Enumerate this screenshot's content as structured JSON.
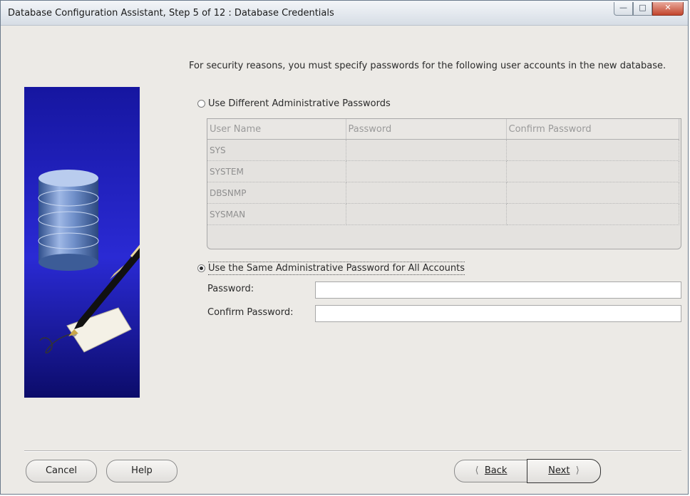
{
  "window": {
    "title": "Database Configuration Assistant, Step 5 of 12 : Database Credentials",
    "controls": [
      "minimize",
      "maximize",
      "close"
    ]
  },
  "intro": "For security reasons, you must specify passwords for the following user accounts in the new database.",
  "options": {
    "different": {
      "label": "Use Different Administrative Passwords",
      "selected": false
    },
    "same": {
      "label": "Use the Same Administrative Password for All Accounts",
      "selected": true
    }
  },
  "grid": {
    "columns": [
      "User Name",
      "Password",
      "Confirm Password"
    ],
    "rows": [
      {
        "user": "SYS",
        "password": "",
        "confirm": ""
      },
      {
        "user": "SYSTEM",
        "password": "",
        "confirm": ""
      },
      {
        "user": "DBSNMP",
        "password": "",
        "confirm": ""
      },
      {
        "user": "SYSMAN",
        "password": "",
        "confirm": ""
      }
    ]
  },
  "fields": {
    "password": {
      "label": "Password:",
      "value": ""
    },
    "confirm": {
      "label": "Confirm Password:",
      "value": ""
    }
  },
  "buttons": {
    "cancel": "Cancel",
    "help": "Help",
    "back": "Back",
    "next": "Next"
  },
  "icons": {
    "back": "chevron-left-icon",
    "next": "chevron-right-icon"
  },
  "colors": {
    "art_blue": "#1a1aa8",
    "title_text": "#1a1a1a",
    "close_red": "#c2452d"
  }
}
